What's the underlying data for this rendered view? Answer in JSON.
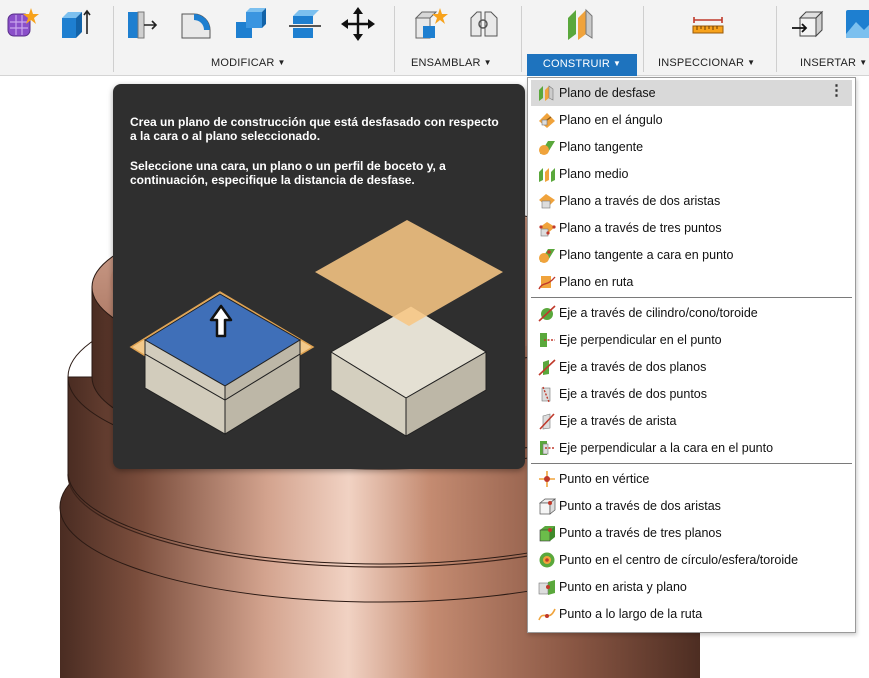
{
  "toolbar": {
    "groups": [
      {
        "label": "MODIFICAR"
      },
      {
        "label": "ENSAMBLAR"
      },
      {
        "label": "CONSTRUIR"
      },
      {
        "label": "INSPECCIONAR"
      },
      {
        "label": "INSERTAR"
      }
    ],
    "caret": "▼"
  },
  "tooltip": {
    "paragraph1": "Crea un plano de construcción que está desfasado con respecto a la cara o al plano seleccionado.",
    "paragraph2": "Seleccione una cara, un plano o un perfil de boceto y, a continuación, especifique la distancia de desfase."
  },
  "menu": {
    "more_glyph": "⋮",
    "items": [
      {
        "label": "Plano de desfase",
        "icon": "offset-plane-icon"
      },
      {
        "label": "Plano en el ángulo",
        "icon": "plane-at-angle-icon"
      },
      {
        "label": "Plano tangente",
        "icon": "tangent-plane-icon"
      },
      {
        "label": "Plano medio",
        "icon": "midplane-icon"
      },
      {
        "label": "Plano a través de dos aristas",
        "icon": "plane-two-edges-icon"
      },
      {
        "label": "Plano a través de tres puntos",
        "icon": "plane-three-points-icon"
      },
      {
        "label": "Plano tangente a cara en punto",
        "icon": "plane-tangent-face-point-icon"
      },
      {
        "label": "Plano en ruta",
        "icon": "plane-along-path-icon"
      },
      {
        "label": "Eje a través de cilindro/cono/toroide",
        "icon": "axis-cylinder-icon"
      },
      {
        "label": "Eje perpendicular en el punto",
        "icon": "axis-perpendicular-point-icon"
      },
      {
        "label": "Eje a través de dos planos",
        "icon": "axis-two-planes-icon"
      },
      {
        "label": "Eje a través de dos puntos",
        "icon": "axis-two-points-icon"
      },
      {
        "label": "Eje a través de arista",
        "icon": "axis-edge-icon"
      },
      {
        "label": "Eje perpendicular a la cara en el punto",
        "icon": "axis-perpendicular-face-icon"
      },
      {
        "label": "Punto en vértice",
        "icon": "point-vertex-icon"
      },
      {
        "label": "Punto a través de dos aristas",
        "icon": "point-two-edges-icon"
      },
      {
        "label": "Punto a través de tres planos",
        "icon": "point-three-planes-icon"
      },
      {
        "label": "Punto en el centro de círculo/esfera/toroide",
        "icon": "point-center-icon"
      },
      {
        "label": "Punto en arista y plano",
        "icon": "point-edge-plane-icon"
      },
      {
        "label": "Punto a lo largo de la ruta",
        "icon": "point-along-path-icon"
      }
    ]
  },
  "colors": {
    "accent": "#1e73be",
    "plane_orange": "#f0a33c",
    "plane_green": "#5aa83c",
    "tooltip_bg": "#2f2f2f"
  }
}
